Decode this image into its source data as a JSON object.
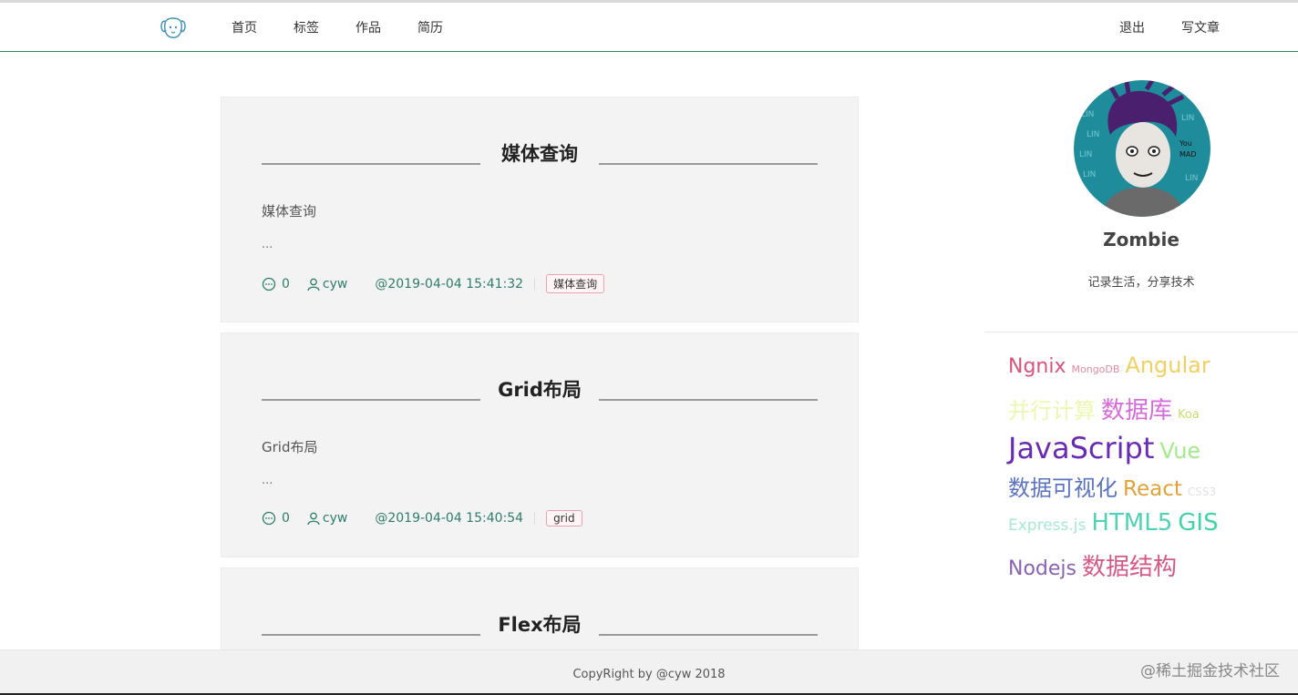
{
  "nav": {
    "left": [
      "首页",
      "标签",
      "作品",
      "简历"
    ],
    "right": [
      "退出",
      "写文章"
    ]
  },
  "posts": [
    {
      "title": "媒体查询",
      "summary": "媒体查询",
      "ellipsis": "...",
      "comments": "0",
      "author": "cyw",
      "date": "@2019-04-04 15:41:32",
      "tag": "媒体查询"
    },
    {
      "title": "Grid布局",
      "summary": "Grid布局",
      "ellipsis": "...",
      "comments": "0",
      "author": "cyw",
      "date": "@2019-04-04 15:40:54",
      "tag": "grid"
    },
    {
      "title": "Flex布局"
    }
  ],
  "profile": {
    "name": "Zombie",
    "motto": "记录生活，分享技术"
  },
  "tag_cloud": [
    [
      {
        "text": "Ngnix",
        "color": "#d9547a",
        "size": 22
      },
      {
        "text": "MongoDB",
        "color": "#e58aa0",
        "size": 11
      },
      {
        "text": "Angular",
        "color": "#f0d060",
        "size": 24
      }
    ],
    [
      {
        "text": "并行计算",
        "color": "#eef7b0",
        "size": 24
      },
      {
        "text": "数据库",
        "color": "#d86bdc",
        "size": 26
      },
      {
        "text": "Koa",
        "color": "#c9dc6e",
        "size": 13
      }
    ],
    [
      {
        "text": "JavaScript",
        "color": "#6a2bb4",
        "size": 32
      },
      {
        "text": "Vue",
        "color": "#a4eb8c",
        "size": 24
      }
    ],
    [
      {
        "text": "数据可视化",
        "color": "#5b74c2",
        "size": 24
      },
      {
        "text": "React",
        "color": "#e2a23a",
        "size": 23
      },
      {
        "text": "CSS3",
        "color": "#e2e2e2",
        "size": 12
      }
    ],
    [
      {
        "text": "Express.js",
        "color": "#a6ead0",
        "size": 17
      },
      {
        "text": "HTML5",
        "color": "#50d2b6",
        "size": 26
      },
      {
        "text": "GIS",
        "color": "#42d2a6",
        "size": 26
      }
    ],
    [
      {
        "text": "Nodejs",
        "color": "#8a62b4",
        "size": 22
      },
      {
        "text": "数据结构",
        "color": "#d55a86",
        "size": 26
      }
    ]
  ],
  "footer": {
    "copyright": "CopyRight by @cyw 2018",
    "watermark": "@稀土掘金技术社区"
  }
}
